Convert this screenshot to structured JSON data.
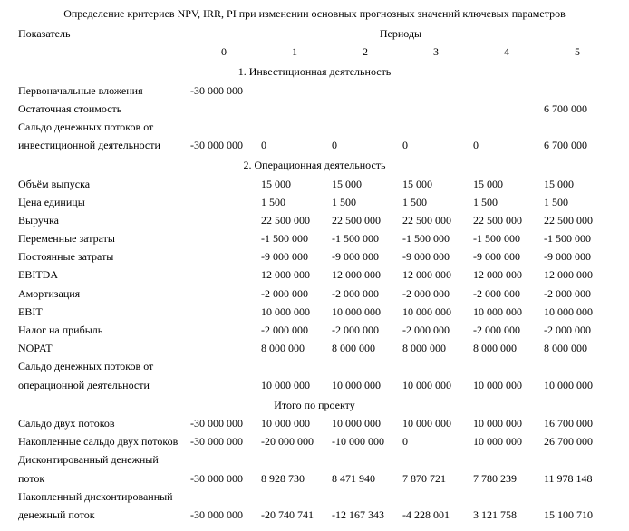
{
  "title": "Определение критериев NPV, IRR, PI при изменении основных прогнозных значений ключевых параметров",
  "header": {
    "indicator": "Показатель",
    "periods": "Периоды",
    "p0": "0",
    "p1": "1",
    "p2": "2",
    "p3": "3",
    "p4": "4",
    "p5": "5"
  },
  "sections": {
    "s1": "1. Инвестиционная деятельность",
    "s2": "2. Операционная деятельность",
    "s3": "Итого по проекту"
  },
  "rows": {
    "r0": {
      "label": "Первоначальные вложения",
      "c0": "-30 000 000",
      "c1": "",
      "c2": "",
      "c3": "",
      "c4": "",
      "c5": ""
    },
    "r1": {
      "label": "Остаточная стоимость",
      "c0": "",
      "c1": "",
      "c2": "",
      "c3": "",
      "c4": "",
      "c5": "6 700 000"
    },
    "r2a": {
      "label": "Сальдо денежных потоков от"
    },
    "r2": {
      "label": "инвестиционной деятельности",
      "c0": "-30 000 000",
      "c1": "0",
      "c2": "0",
      "c3": "0",
      "c4": "0",
      "c5": "6 700 000"
    },
    "r3": {
      "label": "Объём выпуска",
      "c0": "",
      "c1": "15 000",
      "c2": "15 000",
      "c3": "15 000",
      "c4": "15 000",
      "c5": "15 000"
    },
    "r4": {
      "label": "Цена единицы",
      "c0": "",
      "c1": "1 500",
      "c2": "1 500",
      "c3": "1 500",
      "c4": "1 500",
      "c5": "1 500"
    },
    "r5": {
      "label": "Выручка",
      "c0": "",
      "c1": "22 500 000",
      "c2": "22 500 000",
      "c3": "22 500 000",
      "c4": "22 500 000",
      "c5": "22 500 000"
    },
    "r6": {
      "label": "Переменные затраты",
      "c0": "",
      "c1": "-1 500 000",
      "c2": "-1 500 000",
      "c3": "-1 500 000",
      "c4": "-1 500 000",
      "c5": "-1 500 000"
    },
    "r7": {
      "label": "Постоянные затраты",
      "c0": "",
      "c1": "-9 000 000",
      "c2": "-9 000 000",
      "c3": "-9 000 000",
      "c4": "-9 000 000",
      "c5": "-9 000 000"
    },
    "r8": {
      "label": "EBITDA",
      "c0": "",
      "c1": "12 000 000",
      "c2": "12 000 000",
      "c3": "12 000 000",
      "c4": "12 000 000",
      "c5": "12 000 000"
    },
    "r9": {
      "label": "Амортизация",
      "c0": "",
      "c1": "-2 000 000",
      "c2": "-2 000 000",
      "c3": "-2 000 000",
      "c4": "-2 000 000",
      "c5": "-2 000 000"
    },
    "r10": {
      "label": "EBIT",
      "c0": "",
      "c1": "10 000 000",
      "c2": "10 000 000",
      "c3": "10 000 000",
      "c4": "10 000 000",
      "c5": "10 000 000"
    },
    "r11": {
      "label": "Налог на прибыль",
      "c0": "",
      "c1": "-2 000 000",
      "c2": "-2 000 000",
      "c3": "-2 000 000",
      "c4": "-2 000 000",
      "c5": "-2 000 000"
    },
    "r12": {
      "label": "NOPAT",
      "c0": "",
      "c1": "8 000 000",
      "c2": "8 000 000",
      "c3": "8 000 000",
      "c4": "8 000 000",
      "c5": "8 000 000"
    },
    "r13a": {
      "label": "Сальдо денежных потоков от"
    },
    "r13": {
      "label": "операционной деятельности",
      "c0": "",
      "c1": "10 000 000",
      "c2": "10 000 000",
      "c3": "10 000 000",
      "c4": "10 000 000",
      "c5": "10 000 000"
    },
    "r14": {
      "label": "Сальдо двух потоков",
      "c0": "-30 000 000",
      "c1": "10 000 000",
      "c2": "10 000 000",
      "c3": "10 000 000",
      "c4": "10 000 000",
      "c5": "16 700 000"
    },
    "r15": {
      "label": "Накопленные сальдо двух потоков",
      "c0": "-30 000 000",
      "c1": "-20 000 000",
      "c2": "-10 000 000",
      "c3": "0",
      "c4": "10 000 000",
      "c5": "26 700 000"
    },
    "r16a": {
      "label": "Дисконтированный денежный"
    },
    "r16": {
      "label": "поток",
      "c0": "-30 000 000",
      "c1": "8 928 730",
      "c2": "8 471 940",
      "c3": "7 870 721",
      "c4": "7 780 239",
      "c5": "11 978 148"
    },
    "r17a": {
      "label": "Накопленный дисконтированный"
    },
    "r17": {
      "label": "денежный поток",
      "c0": "-30 000 000",
      "c1": "-20 740 741",
      "c2": "-12 167 343",
      "c3": "-4 228 001",
      "c4": "3 121 758",
      "c5": "15 100 710"
    }
  }
}
